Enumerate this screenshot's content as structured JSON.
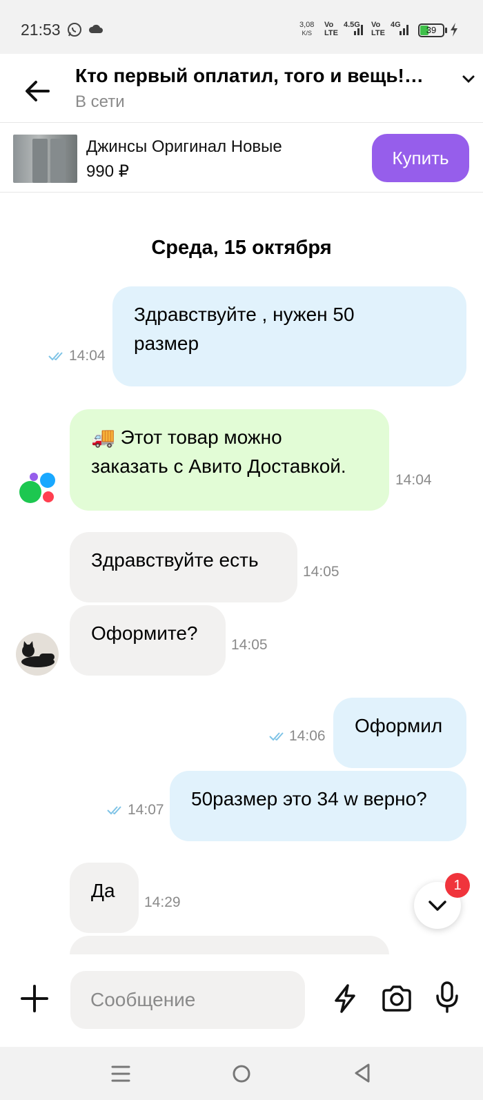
{
  "status_bar": {
    "time": "21:53",
    "speed_value": "3,08",
    "speed_unit": "K/S",
    "net1_top": "Vo",
    "net1_bottom": "LTE",
    "net2": "4.5G",
    "net3_top": "Vo",
    "net3_bottom": "LTE",
    "net4": "4G",
    "battery": "39",
    "battery_level": 0.39,
    "battery_color": "#3fc04a"
  },
  "header": {
    "title": "Кто первый оплатил, того и вещь!…",
    "status": "В сети"
  },
  "item": {
    "title": "Джинсы Оригинал Новые",
    "price": "990 ₽",
    "buy_label": "Купить",
    "buy_color": "#965eeb"
  },
  "date_separator": "Среда, 15 октября",
  "messages": [
    {
      "text_lines": [
        "Здравствуйте , нужен 50",
        "размер"
      ],
      "time": "14:04",
      "direction": "outgoing",
      "read": true
    },
    {
      "emoji": "🚚",
      "text_lines": [
        "Этот товар можно",
        "заказать с Авито Доставкой."
      ],
      "time": "14:04",
      "direction": "system"
    },
    {
      "text": "Здравствуйте есть",
      "time": "14:05",
      "direction": "incoming"
    },
    {
      "text": "Оформите?",
      "time": "14:05",
      "direction": "incoming"
    },
    {
      "text": "Оформил",
      "time": "14:06",
      "direction": "outgoing",
      "read": true
    },
    {
      "text": "50размер это 34 w верно?",
      "time": "14:07",
      "direction": "outgoing",
      "read": true
    },
    {
      "text": "Да",
      "time": "14:29",
      "direction": "incoming"
    }
  ],
  "unread_count": "1",
  "composer": {
    "placeholder": "Сообщение"
  },
  "colors": {
    "outgoing_bubble": "#e1f2fc",
    "incoming_bubble": "#f2f1f0",
    "delivery_bubble": "#e2fcd6",
    "read_check": "#7ec3e6",
    "badge": "#f0343c"
  },
  "icons": [
    "whatsapp-icon",
    "cloud-icon",
    "signal-icon",
    "battery-icon",
    "charging-icon",
    "back-arrow-icon",
    "chevron-down-icon",
    "read-receipt-icon",
    "avito-logo-icon",
    "plus-icon",
    "lightning-icon",
    "camera-icon",
    "microphone-icon",
    "nav-menu-icon",
    "nav-home-icon",
    "nav-back-icon"
  ]
}
